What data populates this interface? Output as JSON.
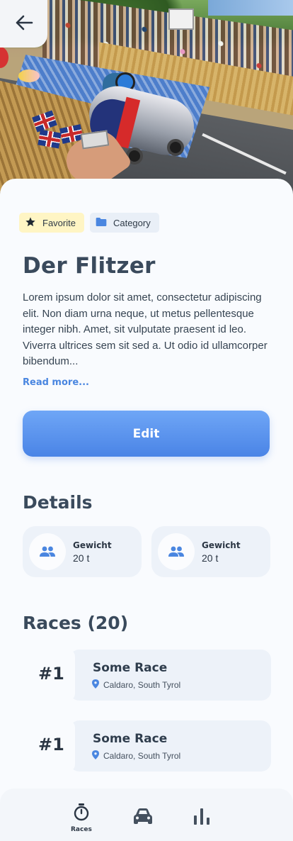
{
  "hero": {
    "image_description": ""
  },
  "header": {
    "back_icon": "arrow-left-icon"
  },
  "tags": {
    "favorite": "Favorite",
    "category": "Category"
  },
  "title": "Der Flitzer",
  "description": "Lorem ipsum dolor sit amet, consectetur adipiscing elit. Non diam urna neque, ut metus pellentesque integer nibh. Amet, sit vulputate praesent id leo. Viverra ultrices sem sit sed a. Ut odio id ullamcorper bibendum...",
  "read_more": "Read more...",
  "edit_label": "Edit",
  "details": {
    "title": "Details",
    "cards": [
      {
        "label": "Gewicht",
        "value": "20 t",
        "icon": "people-icon"
      },
      {
        "label": "Gewicht",
        "value": "20 t",
        "icon": "people-icon"
      }
    ]
  },
  "races": {
    "title": "Races (20)",
    "items": [
      {
        "rank": "#1",
        "name": "Some Race",
        "location": "Caldaro, South Tyrol"
      },
      {
        "rank": "#1",
        "name": "Some Race",
        "location": "Caldaro, South Tyrol"
      }
    ]
  },
  "nav": {
    "items": [
      {
        "label": "Races",
        "icon": "stopwatch-icon",
        "active": true
      },
      {
        "label": "",
        "icon": "car-icon",
        "active": false
      },
      {
        "label": "",
        "icon": "bar-chart-icon",
        "active": false
      }
    ]
  },
  "colors": {
    "accent": "#4a86e0",
    "text_dark": "#3a4a5c",
    "card_bg": "#edf2f9",
    "favorite_bg": "#fff5c4"
  }
}
